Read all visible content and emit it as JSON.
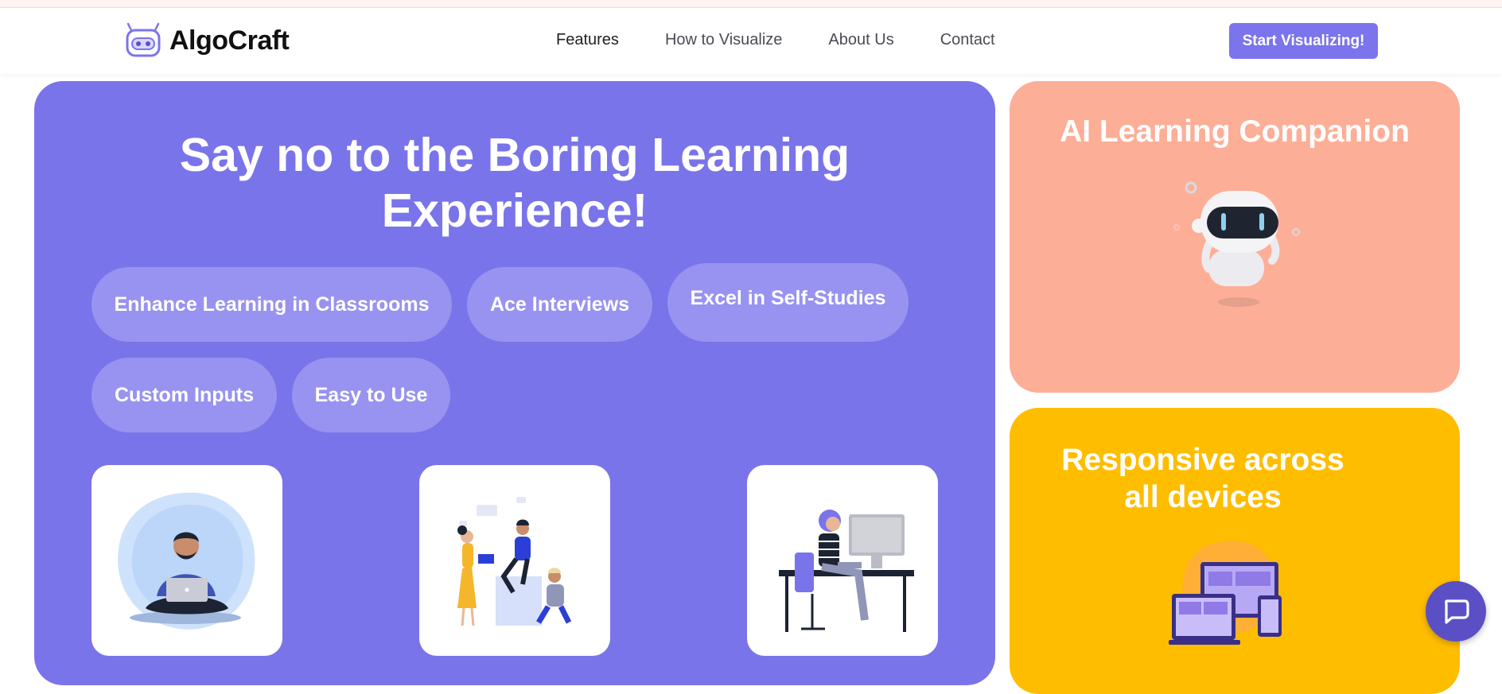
{
  "brand": {
    "name": "AlgoCraft"
  },
  "nav": {
    "links": [
      "Features",
      "How to Visualize",
      "About Us",
      "Contact"
    ],
    "cta": "Start Visualizing!"
  },
  "hero": {
    "title_line1": "Say no to the Boring Learning",
    "title_line2": "Experience!",
    "pills": [
      "Enhance Learning in Classrooms",
      "Ace Interviews",
      "Excel in Self-Studies",
      "Custom Inputs",
      "Easy to Use"
    ]
  },
  "companion": {
    "title": "AI Learning Companion"
  },
  "responsive": {
    "title": "Responsive across all devices"
  },
  "colors": {
    "primary": "#7a74ea",
    "pill": "#9893f0",
    "peach": "#fdae97",
    "yellow": "#ffbd00",
    "cta": "#7b74ec",
    "chat": "#5b4fc6"
  },
  "icons": [
    "robot-logo-icon",
    "chat-icon"
  ]
}
